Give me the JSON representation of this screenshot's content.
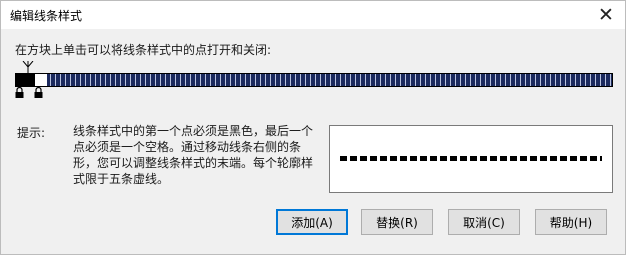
{
  "window": {
    "title": "编辑线条样式",
    "close_glyph": "✕"
  },
  "instruction": "在方块上单击可以将线条样式中的点打开和关闭:",
  "hint": {
    "label": "提示:",
    "text": "线条样式中的第一个点必须是黑色，最后一个点必须是一个空格。通过移动线条右侧的条形，您可以调整线条样式的末端。每个轮廓样式限于五条虚线。"
  },
  "buttons": {
    "add": "添加(A)",
    "replace": "替换(R)",
    "cancel": "取消(C)",
    "help": "帮助(H)"
  },
  "colors": {
    "track_fill": "#1c2a5e",
    "default_button_border": "#0078d7"
  }
}
